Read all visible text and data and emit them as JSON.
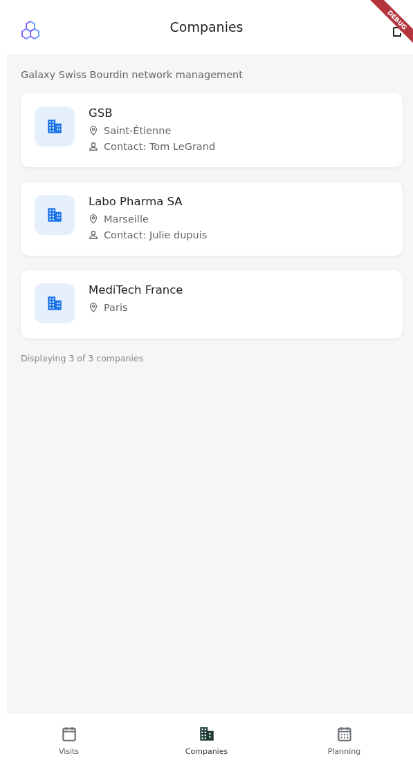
{
  "app_bar": {
    "title": "Companies",
    "debug_banner": "DEBUG"
  },
  "subtitle": "Galaxy Swiss Bourdin network management",
  "companies": [
    {
      "name": "GSB",
      "city": "Saint-Étienne",
      "contact": "Contact: Tom LeGrand"
    },
    {
      "name": "Labo Pharma SA",
      "city": "Marseille",
      "contact": "Contact: Julie dupuis"
    },
    {
      "name": "MediTech France",
      "city": "Paris"
    }
  ],
  "footer": "Displaying 3 of 3 companies",
  "nav": [
    {
      "label": "Visits",
      "kind": "visits",
      "selected": false
    },
    {
      "label": "Companies",
      "kind": "companies",
      "selected": true
    },
    {
      "label": "Planning",
      "kind": "planning",
      "selected": false
    }
  ]
}
